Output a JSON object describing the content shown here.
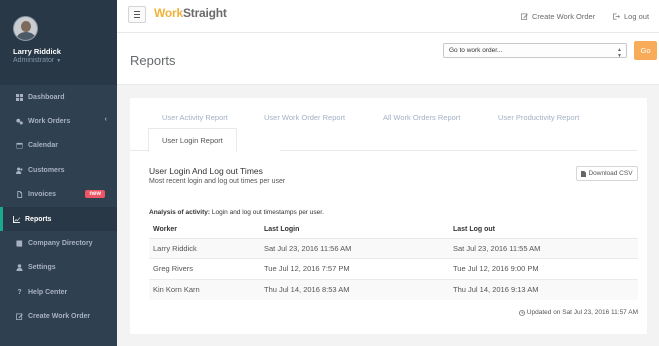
{
  "sidebar": {
    "profile": {
      "name": "Larry Riddick",
      "role": "Administrator"
    },
    "items": [
      {
        "label": "Dashboard",
        "icon": "dashboard-icon"
      },
      {
        "label": "Work Orders",
        "icon": "gears-icon"
      },
      {
        "label": "Calendar",
        "icon": "calendar-icon"
      },
      {
        "label": "Customers",
        "icon": "users-icon"
      },
      {
        "label": "Invoices",
        "icon": "file-icon",
        "badge": "new"
      },
      {
        "label": "Reports",
        "icon": "chart-icon",
        "active": true
      },
      {
        "label": "Company Directory",
        "icon": "book-icon"
      },
      {
        "label": "Settings",
        "icon": "user-icon"
      },
      {
        "label": "Help Center",
        "icon": "question-icon"
      },
      {
        "label": "Create Work Order",
        "icon": "edit-icon"
      }
    ]
  },
  "topbar": {
    "brand_part1": "Work",
    "brand_part2": "Straight",
    "create_label": "Create Work Order",
    "logout_label": "Log out"
  },
  "heading": {
    "title": "Reports",
    "select_value": "Go to work order...",
    "go_label": "Go"
  },
  "tabs": [
    {
      "label": "User Activity Report"
    },
    {
      "label": "User Work Order Report"
    },
    {
      "label": "All Work Orders Report"
    },
    {
      "label": "User Productivity Report"
    },
    {
      "label": "User Login Report",
      "active": true
    }
  ],
  "section": {
    "title": "User Login And Log out Times",
    "subtitle": "Most recent login and log out times per user",
    "csv_label": "Download CSV",
    "analysis_label": "Analysis of activity:",
    "analysis_text": " Login and log out timestamps per user."
  },
  "table": {
    "headers": [
      "Worker",
      "Last Login",
      "Last Log out"
    ],
    "rows": [
      [
        "Larry Riddick",
        "Sat Jul 23, 2016 11:56 AM",
        "Sat Jul 23, 2016 11:55 AM"
      ],
      [
        "Greg Rivers",
        "Tue Jul 12, 2016 7:57 PM",
        "Tue Jul 12, 2016 9:00 PM"
      ],
      [
        "Kin Korn Karn",
        "Thu Jul 14, 2016 8:53 AM",
        "Thu Jul 14, 2016 9:13 AM"
      ]
    ]
  },
  "updated": "Updated on Sat Jul 23, 2016 11:57 AM",
  "colors": {
    "sidebar": "#2f4050",
    "accent": "#19aa8d",
    "go": "#f8ac59",
    "badge": "#ed5565"
  }
}
